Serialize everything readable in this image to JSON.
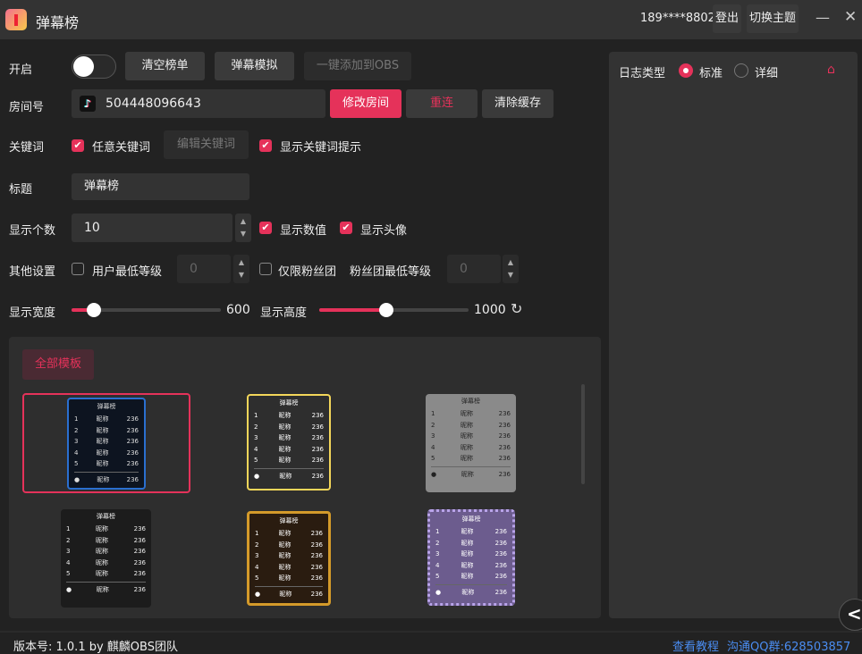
{
  "app": {
    "title": "弹幕榜",
    "user": "189****8802",
    "logout": "登出",
    "theme": "切换主题"
  },
  "row1": {
    "label": "开启",
    "toggle_on": false,
    "clear": "清空榜单",
    "simulate": "弹幕模拟",
    "add_obs": "一键添加到OBS"
  },
  "row2": {
    "label": "房间号",
    "room": "504448096643",
    "modify": "修改房间",
    "reconnect": "重连",
    "clear_cache": "清除缓存"
  },
  "row3": {
    "label": "关键词",
    "any_keyword": "任意关键词",
    "edit_keyword": "编辑关键词",
    "show_hint": "显示关键词提示"
  },
  "row4": {
    "label": "标题",
    "title_value": "弹幕榜"
  },
  "row5": {
    "label": "显示个数",
    "count": "10",
    "show_value": "显示数值",
    "show_avatar": "显示头像"
  },
  "row6": {
    "label": "其他设置",
    "min_level": "用户最低等级",
    "min_level_value": "0",
    "fans_only": "仅限粉丝团",
    "fans_min_level": "粉丝团最低等级",
    "fans_min_level_value": "0"
  },
  "row7": {
    "width_label": "显示宽度",
    "width_value": "600",
    "width_fraction": 0.15,
    "height_label": "显示高度",
    "height_value": "1000",
    "height_fraction": 0.45
  },
  "templates": {
    "tab": "全部模板",
    "preview": {
      "title": "弹幕榜",
      "name": "昵称",
      "score": "236",
      "ranks": [
        "1",
        "2",
        "3",
        "4",
        "5"
      ]
    }
  },
  "log": {
    "label": "日志类型",
    "standard": "标准",
    "detail": "详细",
    "selected": "标准"
  },
  "footer": {
    "version": "版本号: 1.0.1 by 麒麟OBS团队",
    "tutorial": "查看教程",
    "qq": "沟通QQ群:628503857"
  },
  "colors": {
    "accent": "#e5325a",
    "link": "#4a8cf0"
  }
}
